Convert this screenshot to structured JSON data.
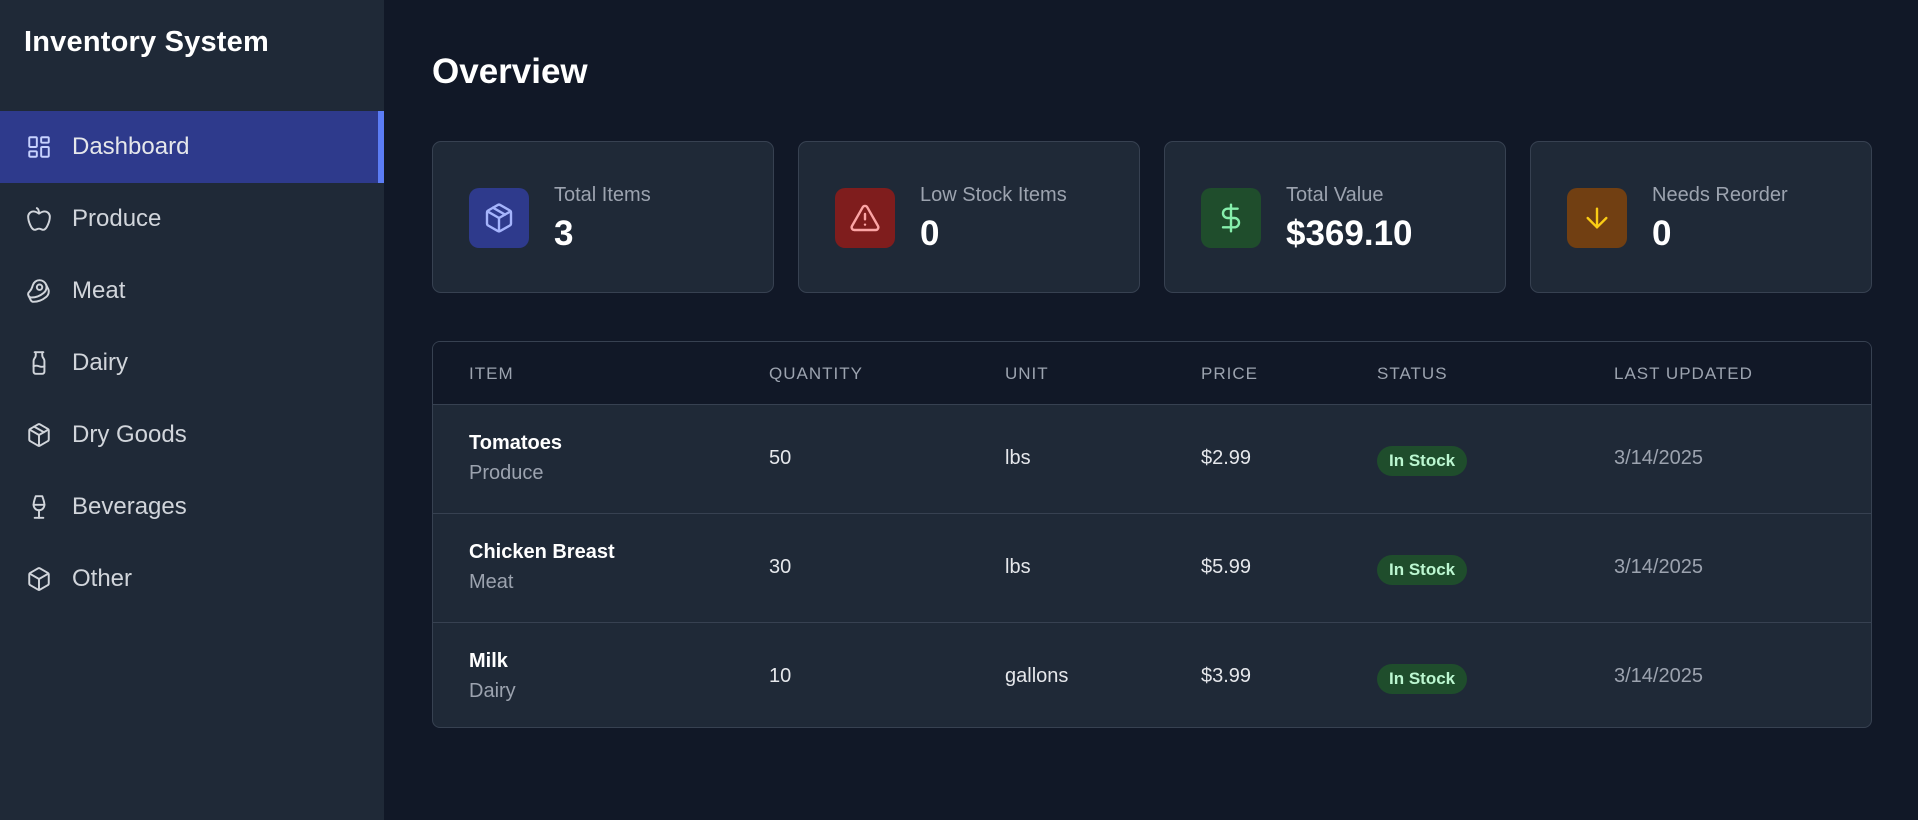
{
  "app": {
    "title": "Inventory System"
  },
  "sidebar": {
    "items": [
      {
        "label": "Dashboard",
        "icon": "dashboard-icon",
        "active": true
      },
      {
        "label": "Produce",
        "icon": "apple-icon",
        "active": false
      },
      {
        "label": "Meat",
        "icon": "beef-icon",
        "active": false
      },
      {
        "label": "Dairy",
        "icon": "milk-icon",
        "active": false
      },
      {
        "label": "Dry Goods",
        "icon": "package-icon",
        "active": false
      },
      {
        "label": "Beverages",
        "icon": "wine-icon",
        "active": false
      },
      {
        "label": "Other",
        "icon": "box-icon",
        "active": false
      }
    ]
  },
  "main": {
    "title": "Overview",
    "cards": [
      {
        "label": "Total Items",
        "value": "3",
        "icon": "package-icon",
        "color": "#2e3a8c"
      },
      {
        "label": "Low Stock Items",
        "value": "0",
        "icon": "alert-triangle-icon",
        "color": "#7f1d1d"
      },
      {
        "label": "Total Value",
        "value": "$369.10",
        "icon": "dollar-icon",
        "color": "#1f4d2c"
      },
      {
        "label": "Needs Reorder",
        "value": "0",
        "icon": "arrow-down-icon",
        "color": "#713f12"
      }
    ],
    "table": {
      "headers": [
        "ITEM",
        "QUANTITY",
        "UNIT",
        "PRICE",
        "STATUS",
        "LAST UPDATED"
      ],
      "rows": [
        {
          "name": "Tomatoes",
          "category": "Produce",
          "quantity": "50",
          "unit": "lbs",
          "price": "$2.99",
          "status": "In Stock",
          "updated": "3/14/2025"
        },
        {
          "name": "Chicken Breast",
          "category": "Meat",
          "quantity": "30",
          "unit": "lbs",
          "price": "$5.99",
          "status": "In Stock",
          "updated": "3/14/2025"
        },
        {
          "name": "Milk",
          "category": "Dairy",
          "quantity": "10",
          "unit": "gallons",
          "price": "$3.99",
          "status": "In Stock",
          "updated": "3/14/2025"
        }
      ]
    }
  },
  "colors": {
    "background": "#111827",
    "sidebar": "#1f2937",
    "accent": "#5b7cf5",
    "status_in_stock": "#1f4d2c"
  }
}
